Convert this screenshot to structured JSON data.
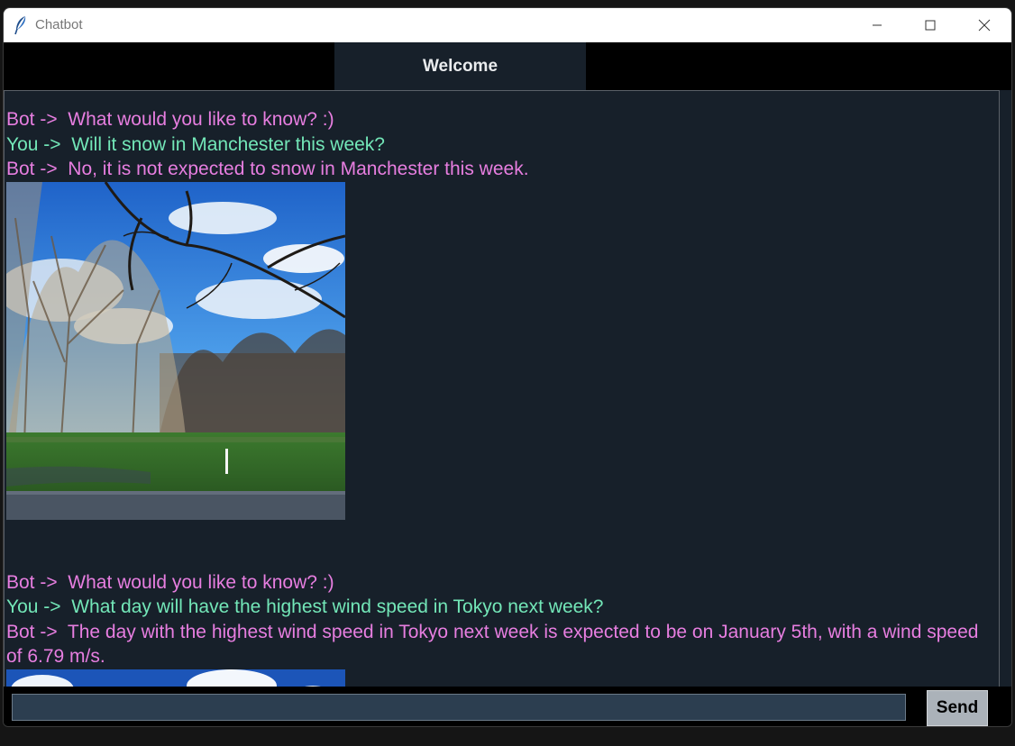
{
  "window": {
    "title": "Chatbot",
    "icon": "feather-icon"
  },
  "header": {
    "tab_label": "Welcome"
  },
  "chat": {
    "messages": [
      {
        "speaker": "bot",
        "text": "Bot ->  What would you like to know? :)"
      },
      {
        "speaker": "you",
        "text": "You ->  Will it snow in Manchester this week?"
      },
      {
        "speaker": "bot",
        "text": "Bot ->  No, it is not expected to snow in Manchester this week."
      },
      {
        "speaker": "bot",
        "text": "Bot ->  What would you like to know? :)"
      },
      {
        "speaker": "you",
        "text": "You ->  What day will have the highest wind speed in Tokyo next week?"
      },
      {
        "speaker": "bot",
        "text": "Bot ->  The day with the highest wind speed in Tokyo next week is expected to be on January 5th, with a wind speed of 6.79 m/s."
      }
    ],
    "images": [
      {
        "depicts": "park-photo-bare-trees-blue-sky"
      },
      {
        "depicts": "sky-photo-partial"
      }
    ]
  },
  "input": {
    "value": "",
    "placeholder": ""
  },
  "send_button": {
    "label": "Send"
  },
  "colors": {
    "background": "#17202a",
    "bot_text": "#e77ee0",
    "you_text": "#73e7b8",
    "input_bg": "#2c3e50",
    "button_bg": "#abb2b9"
  }
}
